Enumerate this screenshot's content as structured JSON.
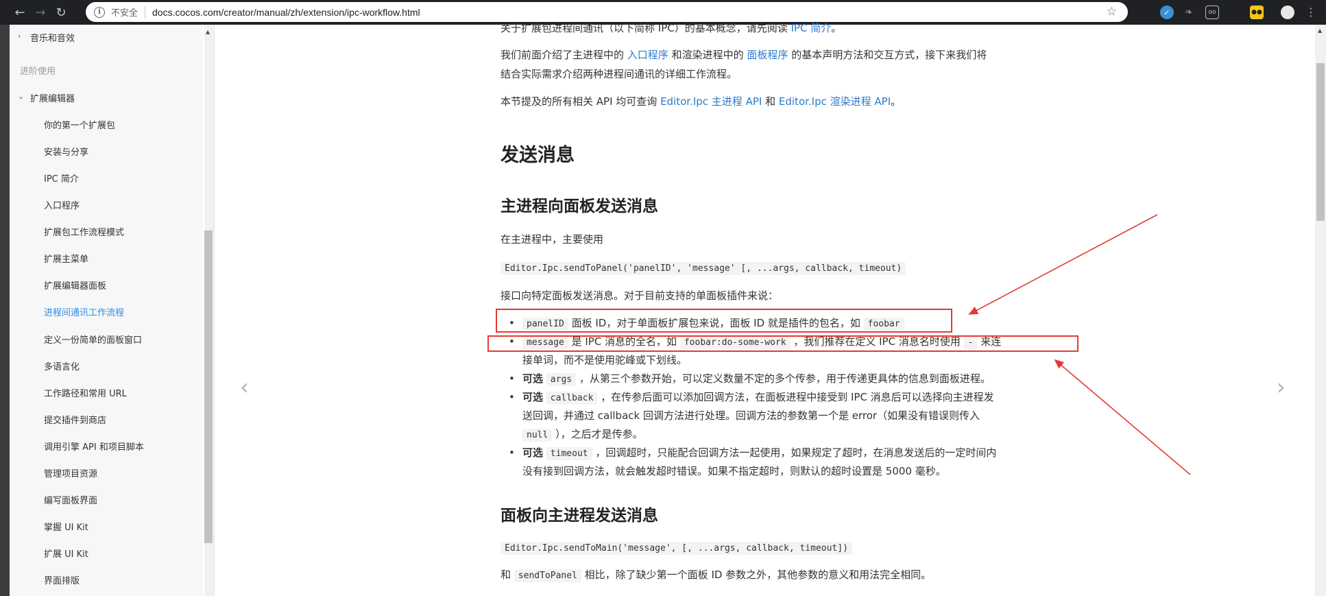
{
  "browser": {
    "insecure_label": "不安全",
    "url": "docs.cocos.com/creator/manual/zh/extension/ipc-workflow.html"
  },
  "sidebar": {
    "items": [
      {
        "label": "音乐和音效",
        "level": 1,
        "toggle": "›"
      },
      {
        "label": "进阶使用",
        "type": "section"
      },
      {
        "label": "扩展编辑器",
        "level": 1,
        "toggle": "⌄"
      },
      {
        "label": "你的第一个扩展包",
        "level": 2
      },
      {
        "label": "安装与分享",
        "level": 2
      },
      {
        "label": "IPC 简介",
        "level": 2
      },
      {
        "label": "入口程序",
        "level": 2
      },
      {
        "label": "扩展包工作流程模式",
        "level": 2
      },
      {
        "label": "扩展主菜单",
        "level": 2
      },
      {
        "label": "扩展编辑器面板",
        "level": 2
      },
      {
        "label": "进程间通讯工作流程",
        "level": 2,
        "active": true
      },
      {
        "label": "定义一份简单的面板窗口",
        "level": 2
      },
      {
        "label": "多语言化",
        "level": 2
      },
      {
        "label": "工作路径和常用 URL",
        "level": 2
      },
      {
        "label": "提交插件到商店",
        "level": 2
      },
      {
        "label": "调用引擎 API 和项目脚本",
        "level": 2
      },
      {
        "label": "管理项目资源",
        "level": 2
      },
      {
        "label": "编写面板界面",
        "level": 2
      },
      {
        "label": "掌握 UI Kit",
        "level": 2
      },
      {
        "label": "扩展 UI Kit",
        "level": 2
      },
      {
        "label": "界面排版",
        "level": 2
      }
    ]
  },
  "content": {
    "intro_cut": "关于扩展包进程间通讯（以下简称 IPC）的基本概念，请先阅读",
    "intro_cut_link": "IPC 简介",
    "intro_cut_end": "。",
    "p1_a": "我们前面介绍了主进程中的",
    "p1_link1": "入口程序",
    "p1_b": "和渲染进程中的",
    "p1_link2": "面板程序",
    "p1_c": "的基本声明方法和交互方式，接下来我们将",
    "p1_line2": "结合实际需求介绍两种进程间通讯的详细工作流程。",
    "p2_a": "本节提及的所有相关 API 均可查询",
    "p2_link1": "Editor.Ipc 主进程 API",
    "p2_b": "和",
    "p2_link2": "Editor.Ipc 渲染进程 API",
    "p2_c": "。",
    "h1_send": "发送消息",
    "h2_main_to_panel": "主进程向面板发送消息",
    "p3": "在主进程中，主要使用",
    "code1": "Editor.Ipc.sendToPanel('panelID', 'message' [, ...args, callback, timeout)",
    "p4": "接口向特定面板发送消息。对于目前支持的单面板插件来说：",
    "li1_code": "panelID",
    "li1_text": "面板 ID，对于单面板扩展包来说，面板 ID 就是插件的包名，如",
    "li1_code2": "foobar",
    "li2_code": "message",
    "li2_text_a": "是 IPC 消息的全名，如",
    "li2_code2": "foobar:do-some-work",
    "li2_text_b": "，我们推荐在定义 IPC 消息名时使用",
    "li2_code3": "-",
    "li2_text_c": "来连",
    "li2_line2": "接单词，而不是使用驼峰或下划线。",
    "optional": "可选",
    "li3_code": "args",
    "li3_text": "，从第三个参数开始，可以定义数量不定的多个传参，用于传递更具体的信息到面板进程。",
    "li4_code": "callback",
    "li4_text": "，在传参后面可以添加回调方法，在面板进程中接受到 IPC 消息后可以选择向主进程发",
    "li4_line2": "送回调，并通过 callback 回调方法进行处理。回调方法的参数第一个是 error（如果没有错误则传入",
    "li4_code2": "null",
    "li4_line3_end": "），之后才是传参。",
    "li5_code": "timeout",
    "li5_text": "，回调超时，只能配合回调方法一起使用，如果规定了超时，在消息发送后的一定时间内",
    "li5_line2": "没有接到回调方法，就会触发超时错误。如果不指定超时，则默认的超时设置是 5000 毫秒。",
    "h2_panel_to_main": "面板向主进程发送消息",
    "code2": "Editor.Ipc.sendToMain('message', [, ...args, callback, timeout])",
    "p5_a": "和",
    "p5_code": "sendToPanel",
    "p5_b": "相比，除了缺少第一个面板 ID 参数之外，其他参数的意义和用法完全相同。"
  },
  "pager": {
    "prev": "‹",
    "next": "›"
  },
  "colors": {
    "link": "#2b7acb",
    "active": "#2b8ce6",
    "annotation": "#e53935"
  }
}
